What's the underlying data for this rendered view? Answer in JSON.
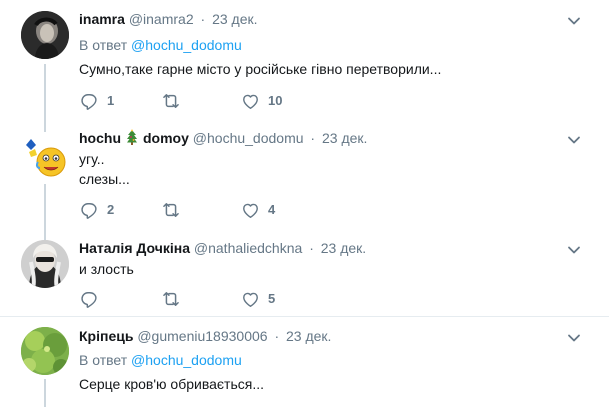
{
  "tweets": [
    {
      "name": "inamra",
      "handle": "@inamra2",
      "separator": "·",
      "date": "23 дек.",
      "reply_prefix": "В ответ",
      "reply_to": "@hochu_dodomu",
      "lines": [
        "Сумно,таке гарне місто у російське гівно перетворили..."
      ],
      "replies": "1",
      "retweets": "",
      "likes": "10"
    },
    {
      "name_part1": "hochu",
      "name_part2": "domoy",
      "handle": "@hochu_dodomu",
      "separator": "·",
      "date": "23 дек.",
      "lines": [
        "угу..",
        "слезы..."
      ],
      "replies": "2",
      "retweets": "",
      "likes": "4"
    },
    {
      "name": "Наталія Дочкіна",
      "handle": "@nathaliedchkna",
      "separator": "·",
      "date": "23 дек.",
      "lines": [
        "и злость"
      ],
      "replies": "",
      "retweets": "",
      "likes": "5"
    },
    {
      "name": "Кріпець",
      "handle": "@gumeniu18930006",
      "separator": "·",
      "date": "23 дек.",
      "reply_prefix": "В ответ",
      "reply_to": "@hochu_dodomu",
      "lines": [
        "Серце кров'ю обривається..."
      ]
    }
  ],
  "icons": {
    "reply": "reply-icon",
    "retweet": "retweet-icon",
    "like": "heart-icon",
    "caret": "chevron-down-icon",
    "name_emoji": "christmas-tree-icon"
  },
  "colors": {
    "text": "#14171a",
    "muted": "#657786",
    "link": "#1da1f2",
    "thread_line": "#ccd6dd",
    "divider": "#e6ecf0"
  }
}
